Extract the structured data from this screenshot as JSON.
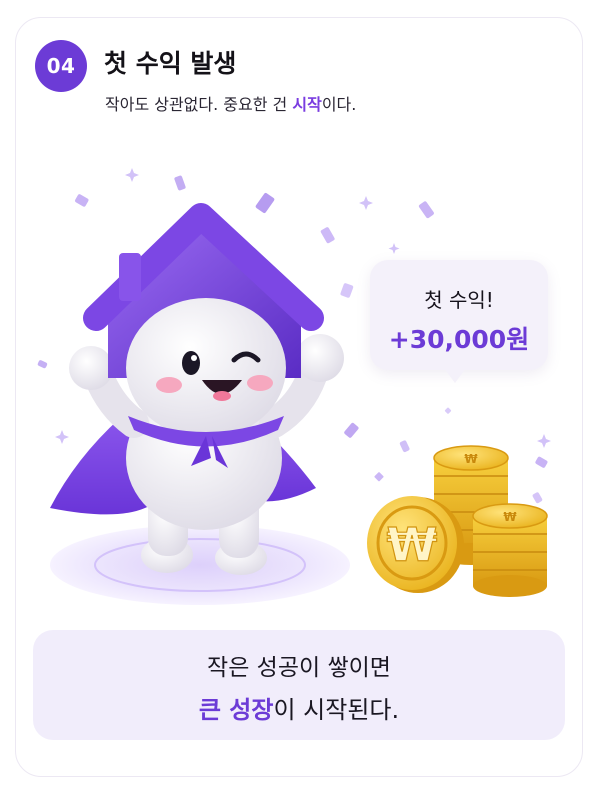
{
  "step": {
    "number": "04",
    "title": "첫 수익 발생"
  },
  "subtitle": {
    "before": "작아도 상관없다. 중요한 건 ",
    "accent": "시작",
    "after": "이다."
  },
  "bubble": {
    "line1": "첫 수익!",
    "amount": "+30,000원"
  },
  "footer": {
    "line1": "작은 성공이 쌓이면",
    "line2_accent": "큰 성장",
    "line2_rest": "이 시작된다."
  },
  "coin_symbol": "₩",
  "colors": {
    "accent": "#6c3bd6",
    "coin": "#f2c12e",
    "panel": "#f1edfb"
  },
  "icons": [
    "house-mascot-icon",
    "won-coin-icon",
    "confetti-icon",
    "sparkle-icon"
  ]
}
